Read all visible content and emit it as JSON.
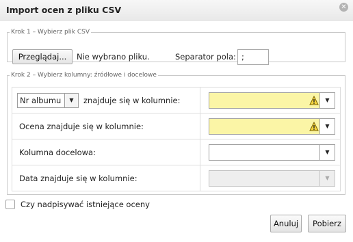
{
  "dialog": {
    "title": "Import ocen z pliku CSV",
    "close_icon": "close-icon"
  },
  "krok1": {
    "legend": "Krok 1 – Wybierz plik CSV",
    "browse_button": "Przeglądaj...",
    "file_status": "Nie wybrano pliku.",
    "separator_label": "Separator pola:",
    "separator_value": ";"
  },
  "krok2": {
    "legend": "Krok 2 – Wybierz kolumny: źródłowe i docelowe",
    "rows": [
      {
        "select_value": "Nr albumu",
        "label": "znajduje się w kolumnie:",
        "combo_value": "",
        "state": "warning"
      },
      {
        "label": "Ocena znajduje się w kolumnie:",
        "combo_value": "",
        "state": "warning"
      },
      {
        "label": "Kolumna docelowa:",
        "combo_value": "",
        "state": "normal"
      },
      {
        "label": "Data znajduje się w kolumnie:",
        "combo_value": "",
        "state": "disabled"
      }
    ]
  },
  "overwrite": {
    "label": "Czy nadpisywać istniejące oceny",
    "checked": false
  },
  "footer": {
    "cancel_button": "Anuluj",
    "fetch_button": "Pobierz"
  },
  "colors": {
    "warning_fill": "#fbf5a6",
    "disabled_fill": "#eeeeee"
  }
}
